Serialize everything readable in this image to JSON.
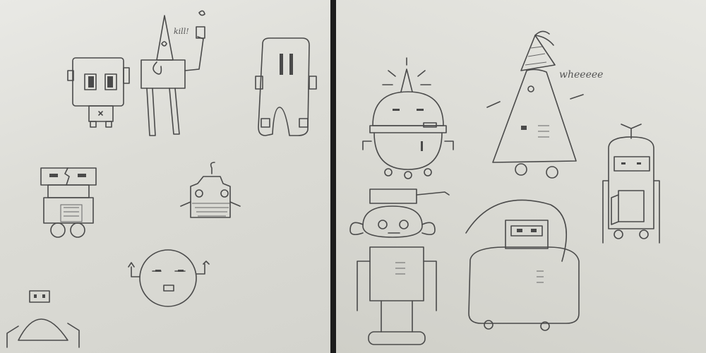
{
  "photo": {
    "left_page_label": "robot-sketches-left",
    "right_page_label": "robot-sketches-right"
  },
  "annotations": {
    "kill_text": "kill!",
    "whee_text": "wheeeee"
  },
  "colors": {
    "paper": "#e3e3de",
    "ink": "#4a4a4a"
  }
}
